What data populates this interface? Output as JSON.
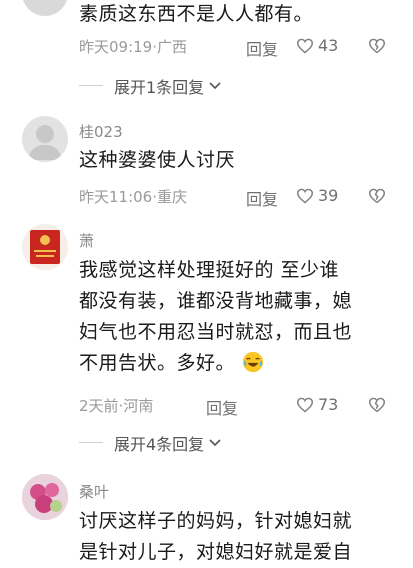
{
  "comments": [
    {
      "text_lines": [
        "素质这东西不是人人都有。"
      ],
      "time": "昨天09:19",
      "location": "广西",
      "reply_label": "回复",
      "likes": "43",
      "expand_label": "展开1条回复"
    },
    {
      "username": "桂023",
      "text_lines": [
        "这种婆婆使人讨厌"
      ],
      "time": "昨天11:06",
      "location": "重庆",
      "reply_label": "回复",
      "likes": "39"
    },
    {
      "username": "萧",
      "text_lines": [
        "我感觉这样处理挺好的 至少谁",
        "都没有装，谁都没背地藏事，媳",
        "妇气也不用忍当时就怼，而且也",
        "不用告状。多好。"
      ],
      "time": "2天前",
      "location": "河南",
      "reply_label": "回复",
      "likes": "73",
      "expand_label": "展开4条回复"
    },
    {
      "username": "桑叶",
      "text_lines": [
        "讨厌这样子的妈妈，针对媳妇就",
        "是针对儿子，对媳妇好就是爱自"
      ]
    }
  ],
  "separator": " · ",
  "colors": {
    "meta": "#9a9a9a",
    "text": "#1a1a1a",
    "icon": "#808080"
  }
}
